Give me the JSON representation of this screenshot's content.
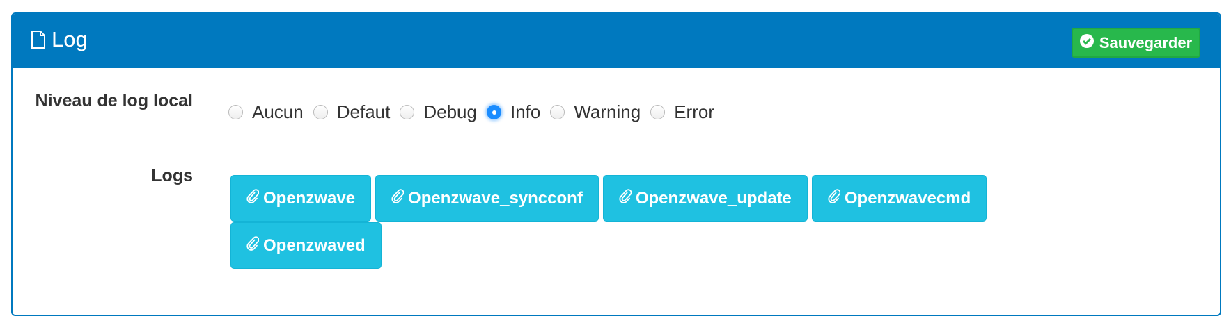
{
  "panel": {
    "title": "Log",
    "title_icon": "file-icon",
    "save_label": "Sauvegarder",
    "save_icon": "check-circle-icon"
  },
  "colors": {
    "header": "#0079bf",
    "save": "#28b84c",
    "log_button": "#1fc1e1",
    "radio_selected": "#1a8cff"
  },
  "log_level": {
    "label": "Niveau de log local",
    "options": [
      "Aucun",
      "Defaut",
      "Debug",
      "Info",
      "Warning",
      "Error"
    ],
    "selected": "Info"
  },
  "logs": {
    "label": "Logs",
    "icon": "paperclip-icon",
    "buttons": [
      "Openzwave",
      "Openzwave_syncconf",
      "Openzwave_update",
      "Openzwavecmd",
      "Openzwaved"
    ]
  }
}
